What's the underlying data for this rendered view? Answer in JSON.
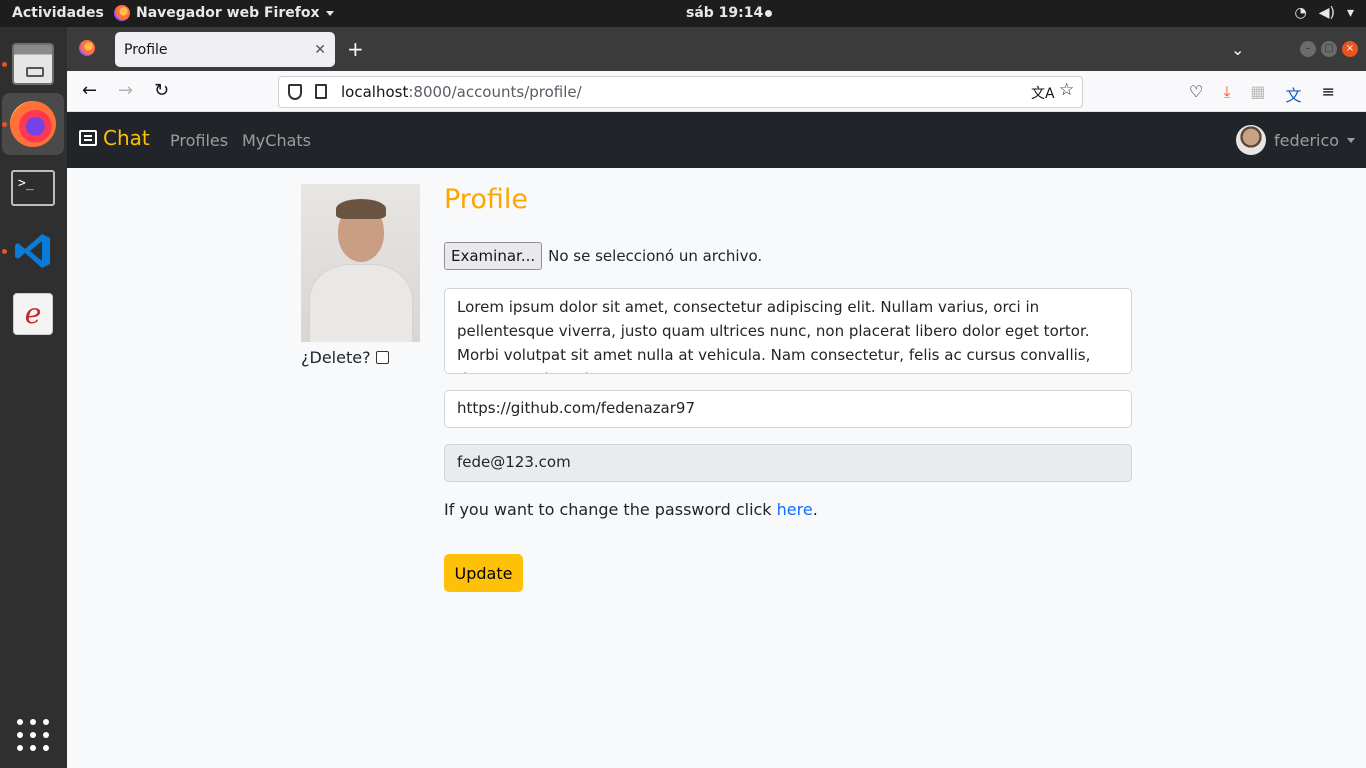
{
  "topbar": {
    "activities": "Actividades",
    "app_menu": "Navegador web Firefox",
    "clock": "sáb 19:14"
  },
  "browser": {
    "tab_title": "Profile",
    "url_host": "localhost",
    "url_path": ":8000/accounts/profile/"
  },
  "site_nav": {
    "brand": "Chat",
    "links": [
      "Profiles",
      "MyChats"
    ],
    "username": "federico"
  },
  "profile": {
    "title": "Profile",
    "delete_label": "¿Delete?",
    "file_button": "Examinar...",
    "file_status": "No se seleccionó un archivo.",
    "bio": "Lorem ipsum dolor sit amet, consectetur adipiscing elit. Nullam varius, orci in pellentesque viverra, justo quam ultrices nunc, non placerat libero dolor eget tortor. Morbi volutpat sit amet nulla at vehicula. Nam consectetur, felis ac cursus convallis, risus tortor interdum",
    "github": "https://github.com/fedenazar97",
    "email": "fede@123.com",
    "password_note_prefix": "If you want to change the password click ",
    "password_link": "here",
    "password_note_suffix": ".",
    "update_button": "Update"
  },
  "colors": {
    "accent": "#ffc107",
    "title": "#ffa500",
    "navbar": "#212529"
  }
}
